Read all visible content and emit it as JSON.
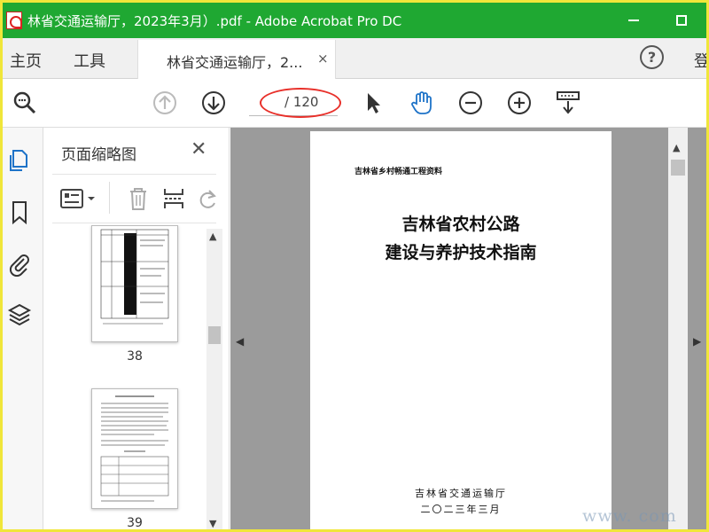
{
  "window": {
    "title": "林省交通运输厅，2023年3月）.pdf - Adobe Acrobat Pro DC",
    "titlebar_color": "#1fa832",
    "frame_color": "#f0e63a"
  },
  "tabs": {
    "home": "主页",
    "tools": "工具",
    "document_tab": "林省交通运输厅，2...",
    "close_symbol": "×",
    "help_symbol": "?",
    "login_partial": "登"
  },
  "toolbar": {
    "page_value": "/ 120",
    "annotation_color": "#e8302a",
    "icons": [
      "search-zoom-icon",
      "page-up-icon",
      "page-down-icon",
      "select-arrow-icon",
      "hand-tool-icon",
      "zoom-out-icon",
      "zoom-in-icon",
      "reading-mode-icon"
    ]
  },
  "sidebar": {
    "icons": [
      "page-thumbnails-icon",
      "bookmark-icon",
      "attachment-icon",
      "layers-icon"
    ],
    "accent": "#1e73c8"
  },
  "thumbnails_panel": {
    "title": "页面缩略图",
    "close_symbol": "✕",
    "thumbnails": [
      {
        "page_label": "38"
      },
      {
        "page_label": "39"
      }
    ]
  },
  "document": {
    "header_line": "吉林省乡村畅通工程资料",
    "title_line1": "吉林省农村公路",
    "title_line2": "建设与养护技术指南",
    "organization": "吉林省交通运输厅",
    "date": "二〇二三年三月"
  },
  "watermark": "www.         com"
}
